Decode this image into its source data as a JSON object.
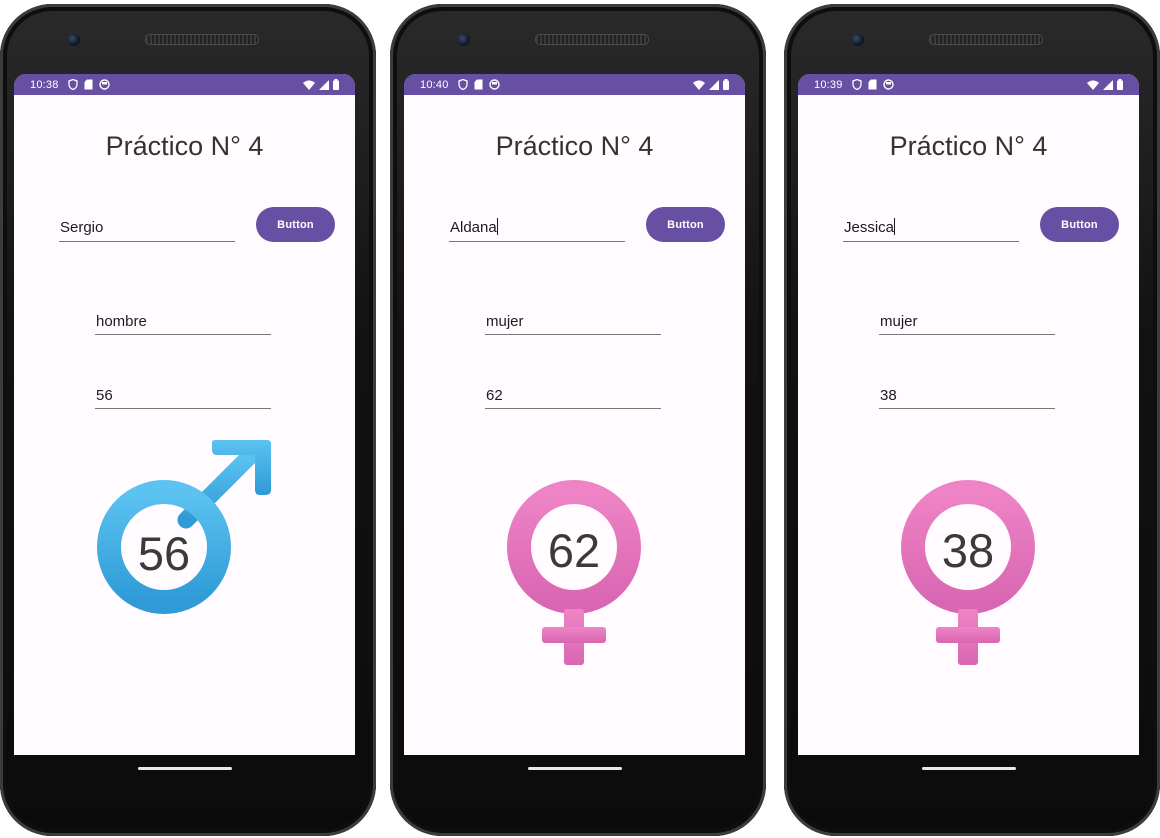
{
  "colors": {
    "status_bar": "#6750a4",
    "button": "#6750a4",
    "male_symbol": "#3aa8e0",
    "female_symbol": "#e373bd",
    "screen_bg": "#fffbfe"
  },
  "phones": [
    {
      "status_time": "10:38",
      "title": "Práctico N° 4",
      "name_value": "Sergio",
      "button_label": "Button",
      "gender_value": "hombre",
      "age_value": "56",
      "symbol_icon": "male-symbol-icon",
      "symbol_number": "56"
    },
    {
      "status_time": "10:40",
      "title": "Práctico N° 4",
      "name_value": "Aldana",
      "button_label": "Button",
      "gender_value": "mujer",
      "age_value": "62",
      "symbol_icon": "female-symbol-icon",
      "symbol_number": "62"
    },
    {
      "status_time": "10:39",
      "title": "Práctico N° 4",
      "name_value": "Jessica",
      "button_label": "Button",
      "gender_value": "mujer",
      "age_value": "38",
      "symbol_icon": "female-symbol-icon",
      "symbol_number": "38"
    }
  ]
}
